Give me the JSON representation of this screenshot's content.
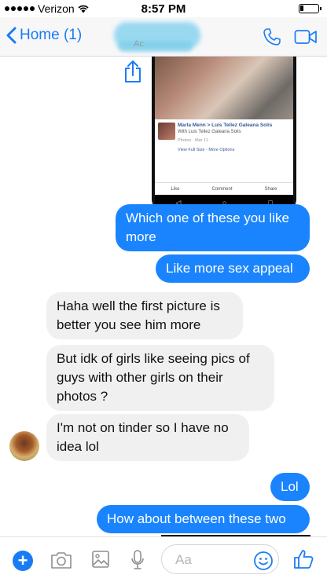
{
  "status_bar": {
    "carrier": "Verizon",
    "time": "8:57 PM"
  },
  "nav": {
    "back_label": "Home (1)",
    "subtitle": "Ac"
  },
  "shared_post": {
    "name_line": "Marla Menn > Luis Tellez Galeana Solis",
    "with_line": "With Luis Tellez Galeana Solis",
    "meta_line": "Photos · Mar 11 · ",
    "options_line": "View Full Size · More Options",
    "like": "Like",
    "comment": "Comment",
    "share": "Share"
  },
  "messages": [
    {
      "from": "me",
      "text": "Which one of these you like more"
    },
    {
      "from": "me",
      "text": "Like more sex appeal"
    },
    {
      "from": "them",
      "text": "Haha well the first picture is better you see him more"
    },
    {
      "from": "them",
      "text": "But idk of girls like seeing pics of guys with other girls on their photos ?"
    },
    {
      "from": "them",
      "text": "I'm not on tinder so I have no idea lol"
    },
    {
      "from": "me",
      "text": "Lol"
    },
    {
      "from": "me",
      "text": "How about between these two"
    }
  ],
  "composer": {
    "placeholder": "Aa"
  },
  "colors": {
    "accent": "#1a7cf5",
    "outgoing_bubble": "#1a84ff",
    "incoming_bubble": "#f0f0f0"
  }
}
